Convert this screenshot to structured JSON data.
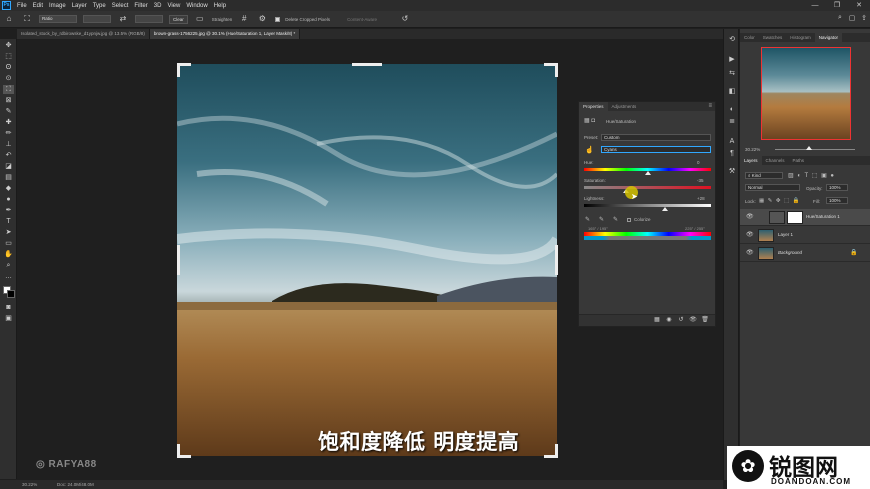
{
  "menubar": {
    "app_logo": "Ps",
    "items": [
      "File",
      "Edit",
      "Image",
      "Layer",
      "Type",
      "Select",
      "Filter",
      "3D",
      "View",
      "Window",
      "Help"
    ],
    "window_controls": [
      "—",
      "❐",
      "✕"
    ]
  },
  "options_bar": {
    "ratio_select": "Ratio",
    "clear_label": "Clear",
    "straighten_label": "Straighten",
    "delete_cropped_label": "Delete Cropped Pixels",
    "content_aware_label": "Content-Aware"
  },
  "tabs": [
    {
      "label": "Isolated_stock_by_rdbirowske_d1ypnjw.jpg @ 13.5% (RGB/8)",
      "active": false
    },
    {
      "label": "brown-grass-1756225.jpg @ 30.1% (Hue/Saturation 1, Layer Mask/8) *",
      "active": true
    }
  ],
  "canvas": {
    "subtitle": "饱和度降低 明度提高",
    "watermark": "RAFYA88"
  },
  "properties": {
    "tabs": [
      "Properties",
      "Adjustments"
    ],
    "title": "Hue/Saturation",
    "preset_label": "Preset:",
    "preset_value": "Custom",
    "channel_value": "Cyans",
    "hue_label": "Hue:",
    "hue_value": "0",
    "saturation_label": "Saturation:",
    "saturation_value": "-35",
    "lightness_label": "Lightness:",
    "lightness_value": "+28",
    "colorize_label": "Colorize",
    "range_left": "165° / 195°",
    "range_right": "225° / 255°",
    "hue_pos": 0.5,
    "saturation_pos": 0.33,
    "lightness_pos": 0.64
  },
  "right_panels": {
    "top_tabs": [
      "Color",
      "Swatches",
      "Histogram",
      "Navigator"
    ],
    "active_top_tab": "Navigator",
    "zoom_value": "30.22%",
    "layer_tabs": [
      "Layers",
      "Channels",
      "Paths"
    ],
    "kind_label": "Kind",
    "blend_mode": "Normal",
    "opacity_label": "Opacity:",
    "opacity_value": "100%",
    "lock_label": "Lock:",
    "fill_label": "Fill:",
    "fill_value": "100%",
    "layers": [
      {
        "name": "Hue/Saturation 1",
        "selected": true
      },
      {
        "name": "Layer 1",
        "selected": false
      },
      {
        "name": "Background",
        "selected": false
      }
    ]
  },
  "status": {
    "zoom": "30.22%",
    "doc_info": "Doc: 24.0M/48.0M"
  },
  "corner_logo": {
    "main": "锐图网",
    "sub": "DOANDOAN.COM"
  },
  "colors": {
    "accent": "#31a8ff",
    "highlight_cursor": "#d4c200",
    "navigator_frame": "#e33333"
  }
}
